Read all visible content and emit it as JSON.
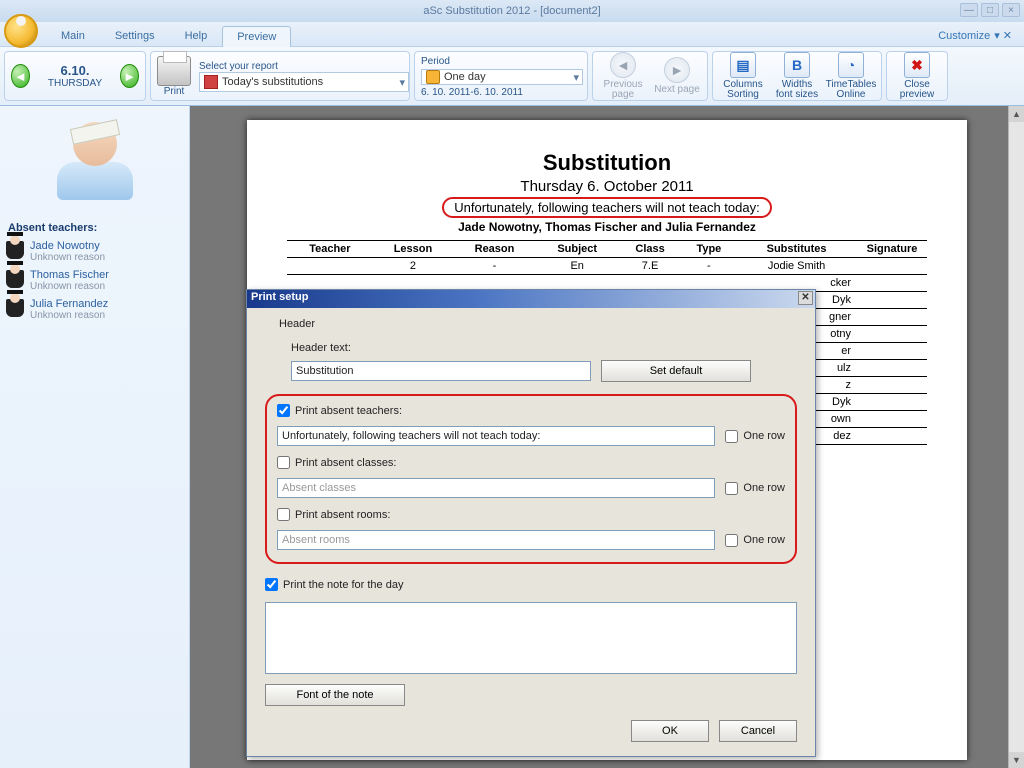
{
  "title": "aSc Substitution 2012  - [document2]",
  "menu": {
    "main": "Main",
    "settings": "Settings",
    "help": "Help",
    "preview": "Preview",
    "customize": "Customize"
  },
  "nav": {
    "date": "6.10.",
    "day": "THURSDAY"
  },
  "ribbon": {
    "print": "Print",
    "select_report": "Select your report",
    "report_value": "Today's substitutions",
    "period": "Period",
    "period_value": "One day",
    "period_range": "6. 10. 2011-6. 10. 2011",
    "prev_page": "Previous page",
    "next_page": "Next page",
    "columns_sorting": "Columns Sorting",
    "widths_fonts": "Widths font sizes",
    "timetables_online": "TimeTables Online",
    "close_preview": "Close preview"
  },
  "sidebar": {
    "header": "Absent teachers:",
    "teachers": [
      {
        "name": "Jade Nowotny",
        "reason": "Unknown reason"
      },
      {
        "name": "Thomas Fischer",
        "reason": "Unknown reason"
      },
      {
        "name": "Julia Fernandez",
        "reason": "Unknown reason"
      }
    ]
  },
  "page": {
    "title": "Substitution",
    "date": "Thursday 6. October 2011",
    "absent_line": "Unfortunately, following teachers will not teach today:",
    "absent_names": "Jade Nowotny, Thomas Fischer and Julia Fernandez",
    "cols": {
      "teacher": "Teacher",
      "lesson": "Lesson",
      "reason": "Reason",
      "subject": "Subject",
      "class": "Class",
      "type": "Type",
      "subs": "Substitutes",
      "sig": "Signature"
    },
    "row1": {
      "lesson": "2",
      "reason": "-",
      "subject": "En",
      "class": "7.E",
      "type": "-",
      "subs": "Jodie Smith"
    },
    "tails": [
      "cker",
      "Dyk",
      "gner",
      "otny",
      "er",
      "ulz",
      "z",
      "Dyk",
      "own",
      "dez"
    ]
  },
  "dialog": {
    "title": "Print setup",
    "header": "Header",
    "header_text_lbl": "Header text:",
    "header_text_val": "Substitution",
    "set_default": "Set default",
    "print_absent_teachers": "Print absent teachers:",
    "absent_teachers_text": "Unfortunately, following teachers will not teach today:",
    "one_row": "One row",
    "print_absent_classes": "Print absent classes:",
    "absent_classes_ph": "Absent classes",
    "print_absent_rooms": "Print absent rooms:",
    "absent_rooms_ph": "Absent rooms",
    "print_note": "Print the note for the day",
    "font_note": "Font of the note",
    "ok": "OK",
    "cancel": "Cancel"
  }
}
